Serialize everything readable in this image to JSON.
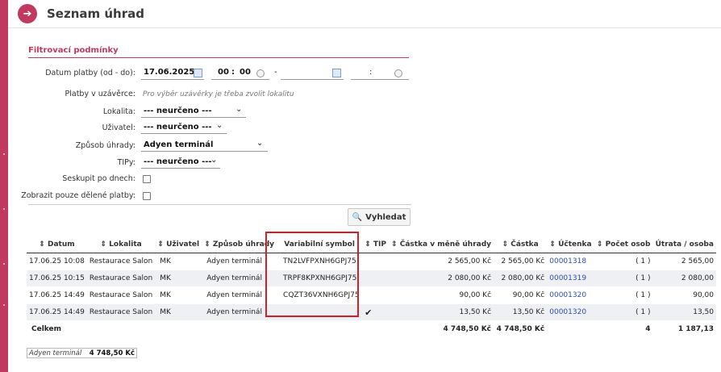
{
  "header": {
    "title": "Seznam úhrad",
    "back_icon": "arrow-right-icon"
  },
  "colors": {
    "accent": "#c0395f",
    "highlight": "#d21f2a",
    "link": "#2b4fa8",
    "tip_check": "#4aa14a"
  },
  "filter": {
    "title": "Filtrovací podmínky",
    "date_label": "Datum platby (od - do):",
    "date_from": "17.06.2025",
    "time_from_h": "00",
    "time_from_sep": ":",
    "time_from_m": "00",
    "range_sep": "-",
    "date_to": "",
    "time_to_sep": ":",
    "closure_label": "Platby v uzávěrce:",
    "closure_hint": "Pro výběr uzávěrky je třeba zvolit lokalitu",
    "locality_label": "Lokalita:",
    "locality_value": "--- neurčeno ---",
    "user_label": "Uživatel:",
    "user_value": "--- neurčeno ---",
    "payment_label": "Způsob úhrady:",
    "payment_value": "Adyen terminál",
    "tips_label": "TIPy:",
    "tips_value": "--- neurčeno ---",
    "group_label": "Seskupit po dnech:",
    "split_label": "Zobrazit pouze dělené platby:",
    "search_label": "Vyhledat"
  },
  "table": {
    "columns": [
      "Datum",
      "Lokalita",
      "Uživatel",
      "Způsob úhrady",
      "Variabilní symbol",
      "TIP",
      "Částka v měně úhrady",
      "Částka",
      "Účtenka",
      "Počet osob",
      "Útrata / osoba"
    ],
    "rows": [
      {
        "date": "17.06.25 10:08",
        "locality": "Restaurace Salon",
        "user": "MK",
        "method": "Adyen terminál",
        "vs": "TN2LVFPXNH6GPJ75",
        "tip": "",
        "amount_cur": "2 565,00 Kč",
        "amount": "2 565,00 Kč",
        "receipt": "00001318",
        "persons": "( 1 )",
        "per_person": "2 565,00"
      },
      {
        "date": "17.06.25 10:15",
        "locality": "Restaurace Salon",
        "user": "MK",
        "method": "Adyen terminál",
        "vs": "TRPF8KPXNH6GPJ75",
        "tip": "",
        "amount_cur": "2 080,00 Kč",
        "amount": "2 080,00 Kč",
        "receipt": "00001319",
        "persons": "( 1 )",
        "per_person": "2 080,00"
      },
      {
        "date": "17.06.25 14:49",
        "locality": "Restaurace Salon",
        "user": "MK",
        "method": "Adyen terminál",
        "vs": "CQZT36VXNH6GPJ75",
        "tip": "",
        "amount_cur": "90,00 Kč",
        "amount": "90,00 Kč",
        "receipt": "00001320",
        "persons": "( 1 )",
        "per_person": "90,00"
      },
      {
        "date": "17.06.25 14:49",
        "locality": "Restaurace Salon",
        "user": "MK",
        "method": "Adyen terminál",
        "vs": "",
        "tip": "✔",
        "amount_cur": "13,50 Kč",
        "amount": "13,50 Kč",
        "receipt": "00001320",
        "persons": "( 1 )",
        "per_person": "13,50"
      }
    ],
    "total": {
      "label": "Celkem",
      "amount_cur": "4 748,50 Kč",
      "amount": "4 748,50 Kč",
      "persons": "4",
      "per_person": "1 187,13"
    }
  },
  "summary": {
    "method": "Adyen terminál",
    "amount": "4 748,50 Kč"
  }
}
